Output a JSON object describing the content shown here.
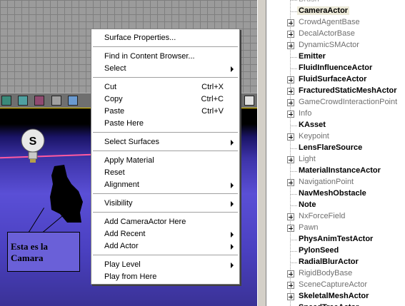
{
  "viewport": {
    "annotation_text": "Esta es la\nCamara"
  },
  "context_menu": {
    "items": [
      {
        "label": "Surface Properties...",
        "shortcut": "",
        "submenu": false
      },
      {
        "label": "Find in Content Browser...",
        "shortcut": "",
        "submenu": false
      },
      {
        "label": "Select",
        "shortcut": "",
        "submenu": true
      },
      {
        "label": "Cut",
        "shortcut": "Ctrl+X",
        "submenu": false
      },
      {
        "label": "Copy",
        "shortcut": "Ctrl+C",
        "submenu": false
      },
      {
        "label": "Paste",
        "shortcut": "Ctrl+V",
        "submenu": false
      },
      {
        "label": "Paste Here",
        "shortcut": "",
        "submenu": false
      },
      {
        "label": "Select Surfaces",
        "shortcut": "",
        "submenu": true
      },
      {
        "label": "Apply Material",
        "shortcut": "",
        "submenu": false
      },
      {
        "label": "Reset",
        "shortcut": "",
        "submenu": false
      },
      {
        "label": "Alignment",
        "shortcut": "",
        "submenu": true
      },
      {
        "label": "Visibility",
        "shortcut": "",
        "submenu": true
      },
      {
        "label": "Add CameraActor Here",
        "shortcut": "",
        "submenu": false
      },
      {
        "label": "Add Recent",
        "shortcut": "",
        "submenu": true
      },
      {
        "label": "Add Actor",
        "shortcut": "",
        "submenu": true
      },
      {
        "label": "Play Level",
        "shortcut": "",
        "submenu": true
      },
      {
        "label": "Play from Here",
        "shortcut": "",
        "submenu": false
      }
    ]
  },
  "class_tree": {
    "items": [
      {
        "label": "Brush",
        "style": "top",
        "expandable": false
      },
      {
        "label": "CameraActor",
        "style": "selected",
        "expandable": false
      },
      {
        "label": "CrowdAgentBase",
        "style": "gray",
        "expandable": true
      },
      {
        "label": "DecalActorBase",
        "style": "gray",
        "expandable": true
      },
      {
        "label": "DynamicSMActor",
        "style": "gray",
        "expandable": true
      },
      {
        "label": "Emitter",
        "style": "bold",
        "expandable": false
      },
      {
        "label": "FluidInfluenceActor",
        "style": "bold",
        "expandable": false
      },
      {
        "label": "FluidSurfaceActor",
        "style": "bold",
        "expandable": true
      },
      {
        "label": "FracturedStaticMeshActor",
        "style": "bold",
        "expandable": true
      },
      {
        "label": "GameCrowdInteractionPoint",
        "style": "gray",
        "expandable": true
      },
      {
        "label": "Info",
        "style": "gray",
        "expandable": true
      },
      {
        "label": "KAsset",
        "style": "bold",
        "expandable": false
      },
      {
        "label": "Keypoint",
        "style": "gray",
        "expandable": true
      },
      {
        "label": "LensFlareSource",
        "style": "bold",
        "expandable": false
      },
      {
        "label": "Light",
        "style": "gray",
        "expandable": true
      },
      {
        "label": "MaterialInstanceActor",
        "style": "bold",
        "expandable": false
      },
      {
        "label": "NavigationPoint",
        "style": "gray",
        "expandable": true
      },
      {
        "label": "NavMeshObstacle",
        "style": "bold",
        "expandable": false
      },
      {
        "label": "Note",
        "style": "bold",
        "expandable": false
      },
      {
        "label": "NxForceField",
        "style": "gray",
        "expandable": true
      },
      {
        "label": "Pawn",
        "style": "gray",
        "expandable": true
      },
      {
        "label": "PhysAnimTestActor",
        "style": "bold",
        "expandable": false
      },
      {
        "label": "PylonSeed",
        "style": "bold",
        "expandable": false
      },
      {
        "label": "RadialBlurActor",
        "style": "bold",
        "expandable": false
      },
      {
        "label": "RigidBodyBase",
        "style": "gray",
        "expandable": true
      },
      {
        "label": "SceneCaptureActor",
        "style": "gray",
        "expandable": true
      },
      {
        "label": "SkeletalMeshActor",
        "style": "bold",
        "expandable": true
      },
      {
        "label": "SpeedTreeActor",
        "style": "bold",
        "expandable": false
      }
    ]
  }
}
